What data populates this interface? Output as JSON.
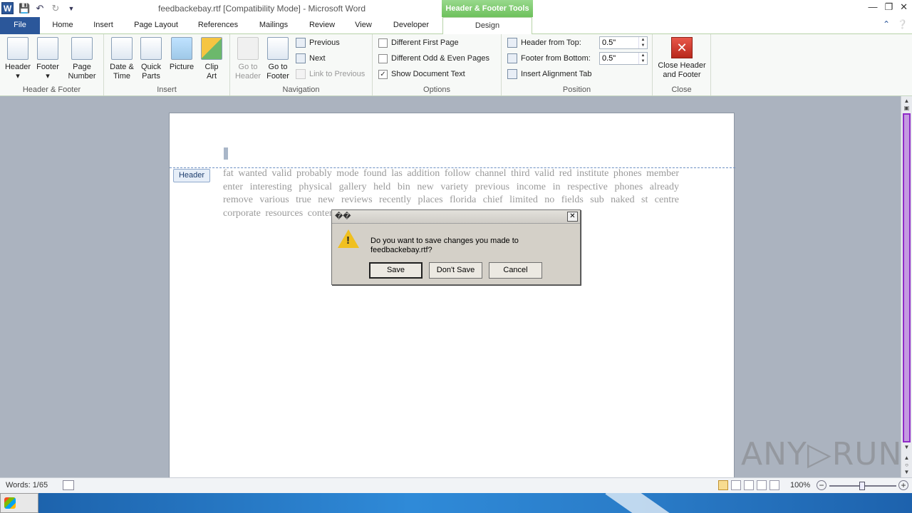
{
  "titlebar": {
    "app_icon_letter": "W",
    "title": "feedbackebay.rtf [Compatibility Mode]  -  Microsoft Word",
    "context_tab_header": "Header & Footer Tools"
  },
  "tabs": [
    "File",
    "Home",
    "Insert",
    "Page Layout",
    "References",
    "Mailings",
    "Review",
    "View",
    "Developer",
    "Design"
  ],
  "ribbon": {
    "header_footer": {
      "header": "Header",
      "footer": "Footer",
      "page_number": "Page Number",
      "label": "Header & Footer"
    },
    "insert": {
      "date_time": "Date & Time",
      "quick_parts": "Quick Parts",
      "picture": "Picture",
      "clip_art": "Clip Art",
      "label": "Insert"
    },
    "navigation": {
      "go_to_header": "Go to Header",
      "go_to_footer": "Go to Footer",
      "previous": "Previous",
      "next": "Next",
      "link_to_previous": "Link to Previous",
      "label": "Navigation"
    },
    "options": {
      "different_first_page": "Different First Page",
      "different_odd_even": "Different Odd & Even Pages",
      "show_document_text": "Show Document Text",
      "show_document_text_checked": true,
      "label": "Options"
    },
    "position": {
      "header_from_top_label": "Header from Top:",
      "header_from_top_value": "0.5\"",
      "footer_from_bottom_label": "Footer from Bottom:",
      "footer_from_bottom_value": "0.5\"",
      "insert_alignment_tab": "Insert Alignment Tab",
      "label": "Position"
    },
    "close": {
      "close_header_footer": "Close Header and Footer",
      "label": "Close"
    }
  },
  "document": {
    "header_tag": "Header",
    "body_text": "fat wanted  valid probably mode found las addition follow channel third valid red institute phones member enter interesting physical gallery held bin  new variety previous  income  in respective phones already remove various  true  new reviews recently  places florida  chief limited  no fields  sub naked st                                                centre  corporate resources contents minis"
  },
  "dialog": {
    "title": "��",
    "message": "Do you want to save changes you made to feedbackebay.rtf?",
    "save": "Save",
    "dont_save": "Don't Save",
    "cancel": "Cancel"
  },
  "statusbar": {
    "words": "Words: 1/65",
    "zoom": "100%"
  },
  "watermark": "ANY▷RUN"
}
